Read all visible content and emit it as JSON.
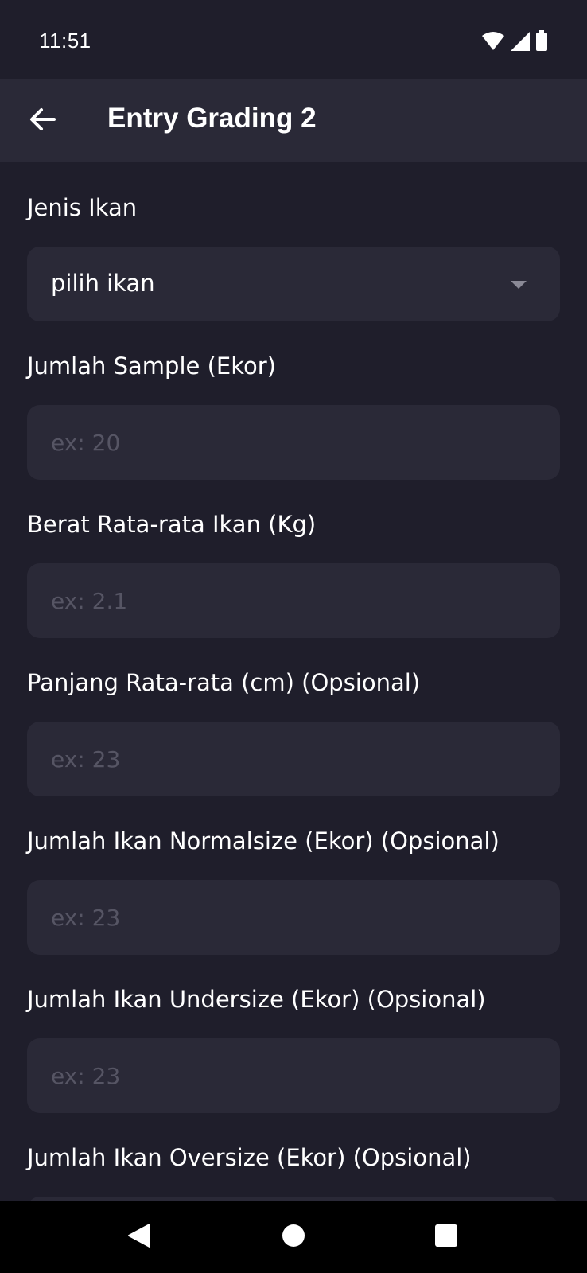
{
  "status_bar": {
    "time": "11:51",
    "icons": [
      "wifi-icon",
      "signal-icon",
      "battery-icon"
    ]
  },
  "app_bar": {
    "title": "Entry Grading 2",
    "back_icon": "arrow-left-icon"
  },
  "form": {
    "jenis_ikan": {
      "label": "Jenis Ikan",
      "value": "pilih ikan"
    },
    "jumlah_sample": {
      "label": "Jumlah Sample (Ekor)",
      "placeholder": "ex: 20",
      "value": ""
    },
    "berat_rata": {
      "label": "Berat Rata-rata Ikan (Kg)",
      "placeholder": "ex: 2.1",
      "value": ""
    },
    "panjang_rata": {
      "label": "Panjang Rata-rata (cm) (Opsional)",
      "placeholder": "ex: 23",
      "value": ""
    },
    "normalsize": {
      "label": "Jumlah Ikan Normalsize (Ekor) (Opsional)",
      "placeholder": "ex: 23",
      "value": ""
    },
    "undersize": {
      "label": "Jumlah Ikan Undersize (Ekor) (Opsional)",
      "placeholder": "ex: 23",
      "value": ""
    },
    "oversize": {
      "label": "Jumlah Ikan Oversize (Ekor) (Opsional)",
      "placeholder": "",
      "value": ""
    }
  },
  "nav_bar": {
    "icons": [
      "back-triangle-icon",
      "home-circle-icon",
      "recents-square-icon"
    ]
  },
  "colors": {
    "background": "#1f1e2b",
    "surface": "#2a2937",
    "placeholder": "#565564",
    "text": "#ffffff"
  }
}
